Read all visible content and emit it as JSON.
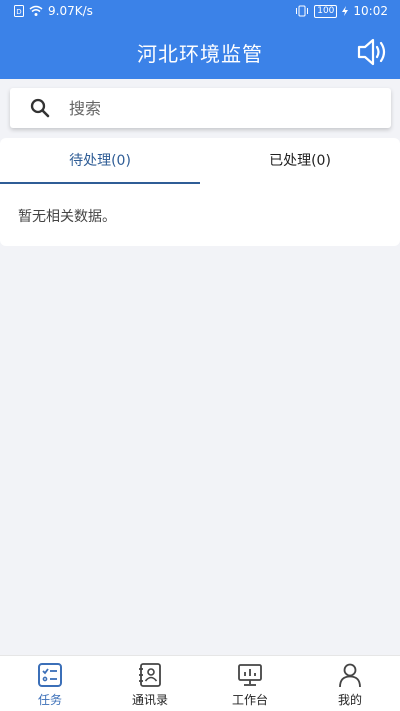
{
  "status_bar": {
    "speed": "9.07K/s",
    "battery": "100",
    "time": "10:02"
  },
  "header": {
    "title": "河北环境监管"
  },
  "search": {
    "placeholder": "搜索"
  },
  "tabs": [
    {
      "label": "待处理(0)",
      "active": true
    },
    {
      "label": "已处理(0)",
      "active": false
    }
  ],
  "empty_message": "暂无相关数据。",
  "bottom_nav": [
    {
      "label": "任务",
      "icon": "task-checklist-icon",
      "active": true
    },
    {
      "label": "通讯录",
      "icon": "contacts-icon",
      "active": false
    },
    {
      "label": "工作台",
      "icon": "workbench-monitor-icon",
      "active": false
    },
    {
      "label": "我的",
      "icon": "profile-person-icon",
      "active": false
    }
  ],
  "colors": {
    "header": "#3b82e8",
    "active_tab": "#2f5d96",
    "background": "#f2f3f7"
  }
}
